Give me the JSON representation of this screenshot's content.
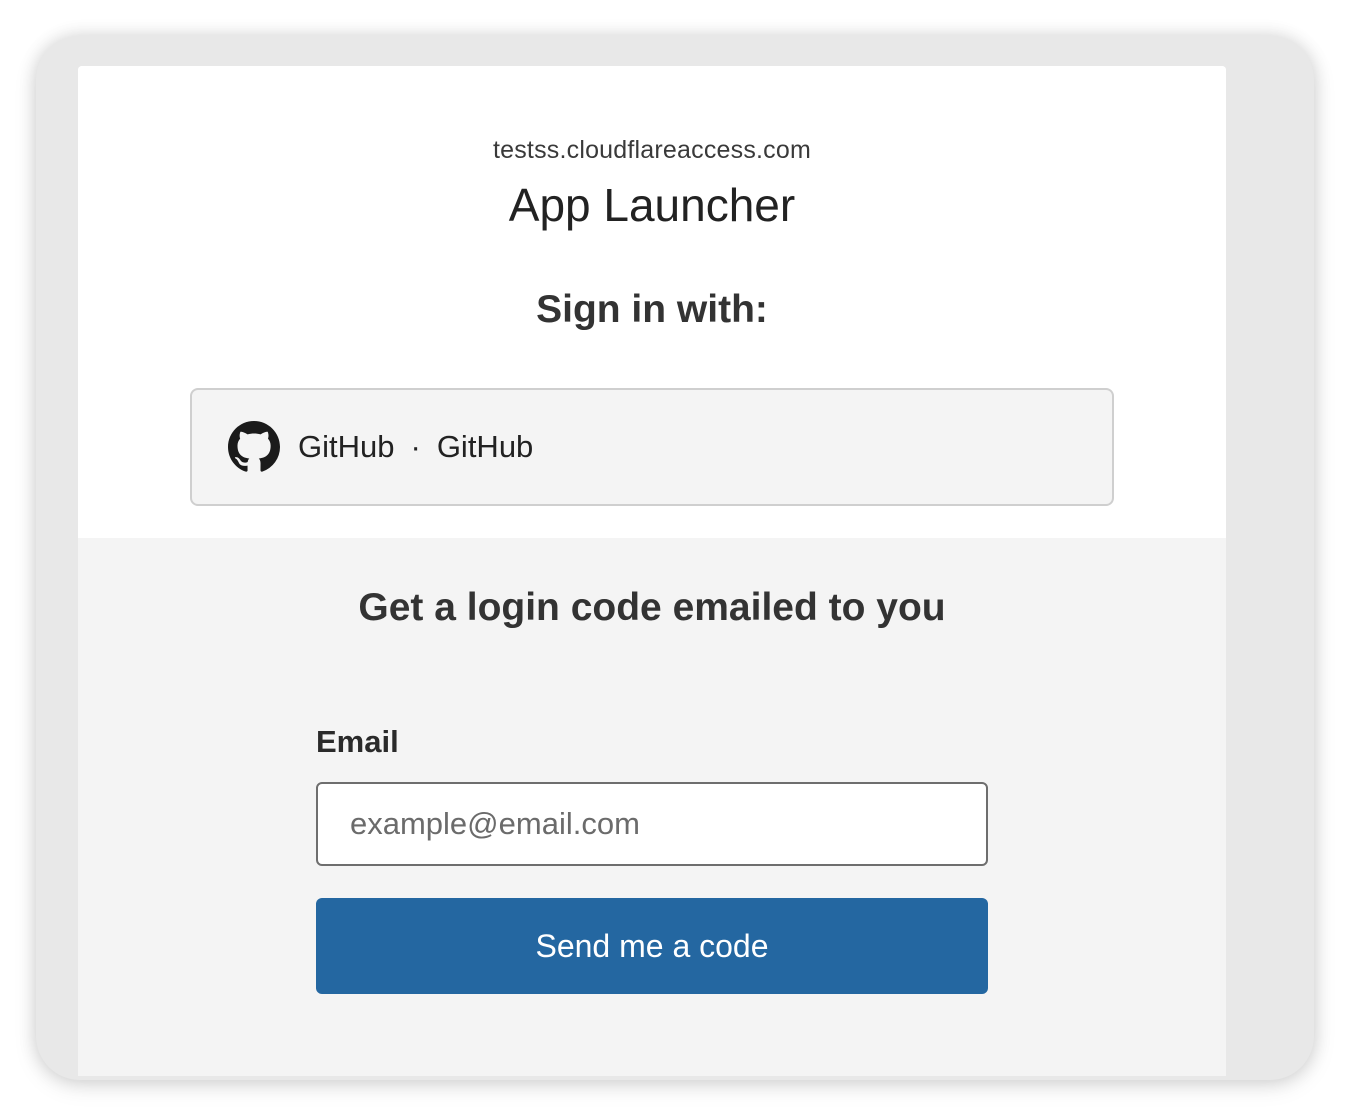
{
  "header": {
    "domain": "testss.cloudflareaccess.com",
    "app_title": "App Launcher"
  },
  "signin": {
    "heading": "Sign in with:",
    "providers": [
      {
        "icon": "github-icon",
        "name": "GitHub",
        "separator": "·",
        "label": "GitHub"
      }
    ]
  },
  "email_login": {
    "heading": "Get a login code emailed to you",
    "email_label": "Email",
    "email_placeholder": "example@email.com",
    "email_value": "",
    "submit_label": "Send me a code"
  },
  "colors": {
    "primary_button": "#2467a1",
    "frame_background": "#e8e8e8",
    "section_background": "#f4f4f4",
    "card_background": "#ffffff"
  }
}
